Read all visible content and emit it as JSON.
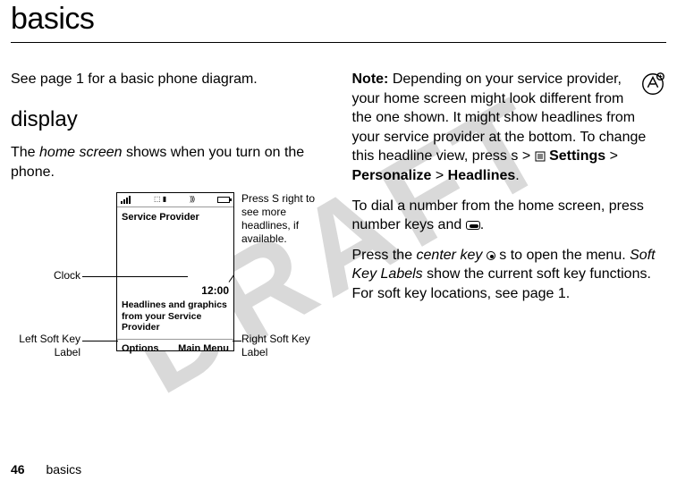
{
  "title": "basics",
  "watermark": "DRAFT",
  "left_col": {
    "intro": "See page 1 for a basic phone diagram.",
    "subhead": "display",
    "body_pre": "The ",
    "body_italic": "home screen",
    "body_post": " shows when you turn on the phone."
  },
  "phone": {
    "service_provider": "Service Provider",
    "clock": "12:00",
    "headline": "Headlines and graphics from your Service Provider",
    "left_softkey": "Options",
    "right_softkey": "Main Menu"
  },
  "callouts": {
    "clock": "Clock",
    "left_soft": "Left Soft Key Label",
    "right_soft": "Right Soft Key Label",
    "press_right": "Press S right to see more headlines, if available."
  },
  "right_col": {
    "note_label": "Note:",
    "note_body": " Depending on your service provider, your home screen might look different from the one shown. It might show headlines from your service provider at the bottom. To change this headline view, press s > ",
    "path1": "Settings",
    "gt1": " > ",
    "path2": "Personalize",
    "gt2": " > ",
    "path3": "Headlines",
    "period1": ".",
    "dial_text": "To dial a number from the home screen, press number keys and ",
    "dial_period": ".",
    "open_pre": "Press the ",
    "open_italic1": "center key",
    "open_mid": " s to open the menu. ",
    "open_italic2": "Soft Key Labels",
    "open_post": " show the current soft key functions. For soft key locations, see page 1."
  },
  "footer": {
    "page": "46",
    "section": "basics"
  }
}
